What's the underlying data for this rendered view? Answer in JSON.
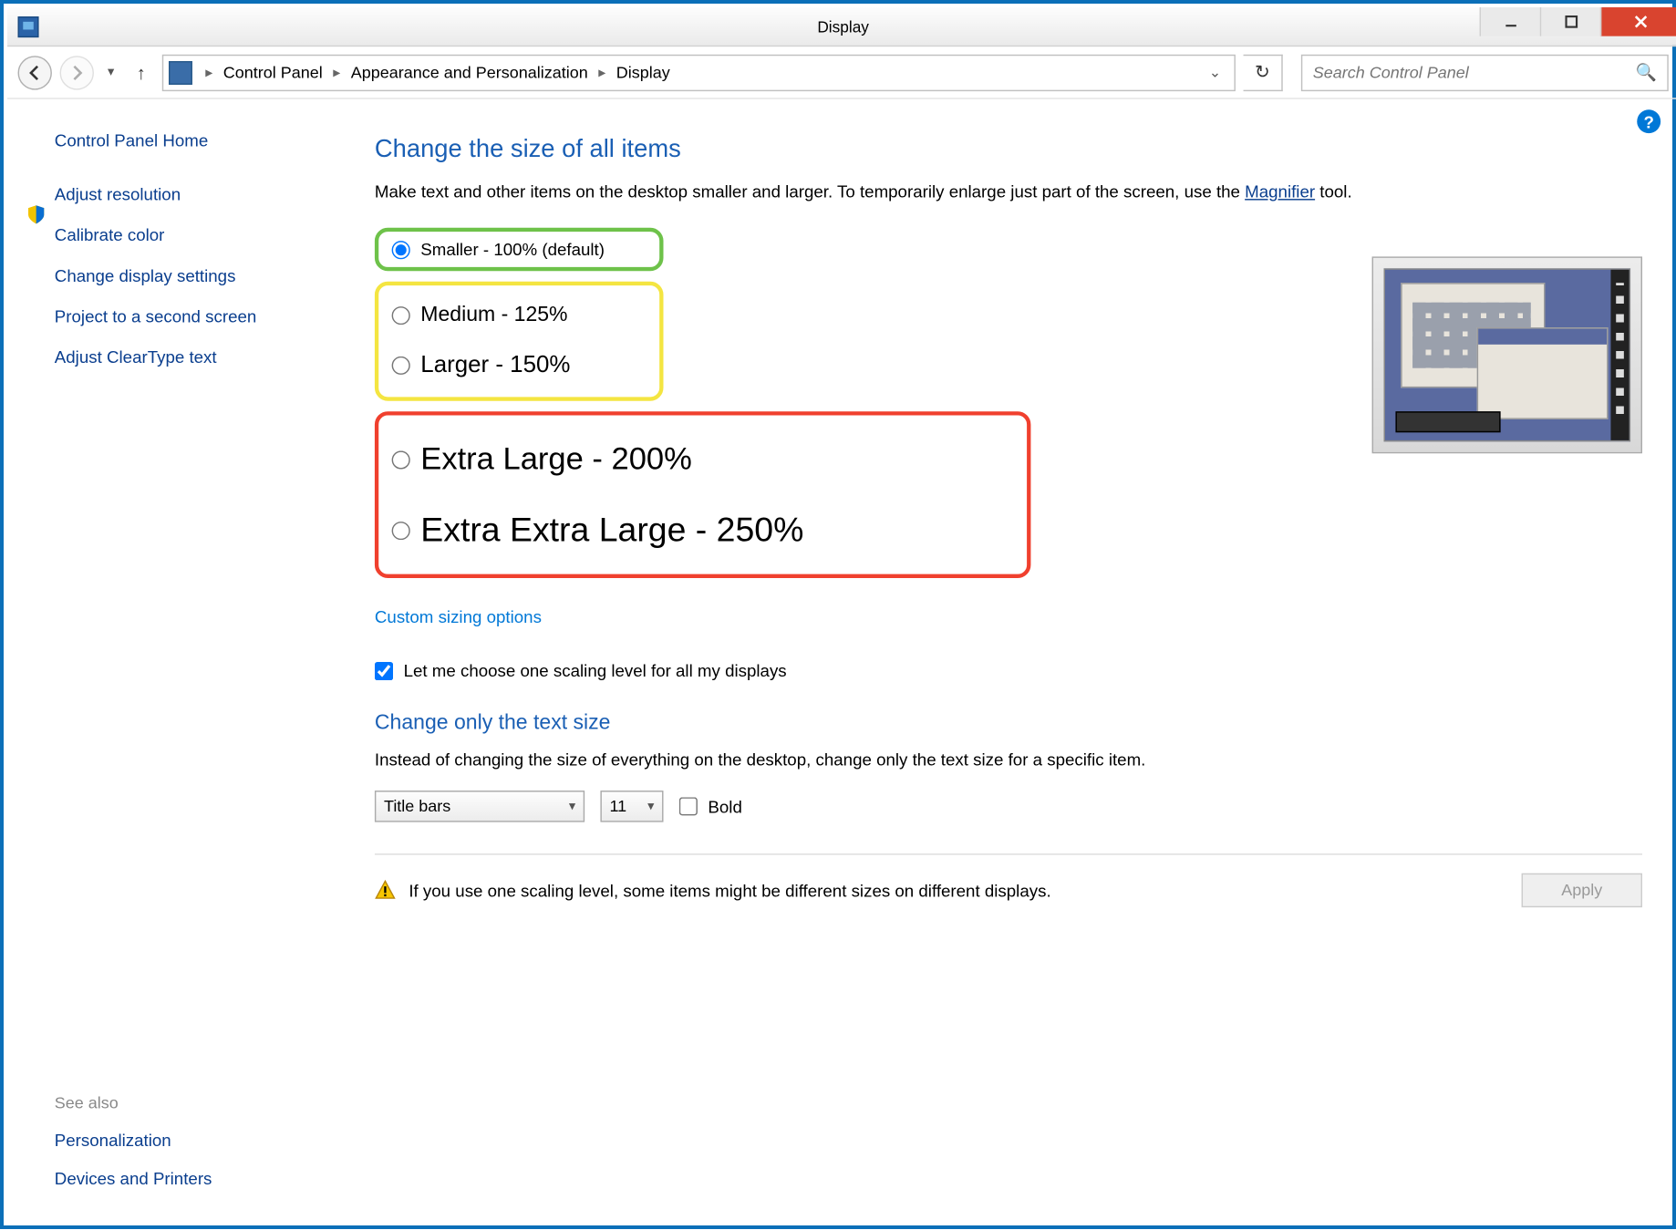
{
  "window": {
    "title": "Display"
  },
  "breadcrumbs": {
    "a": "Control Panel",
    "b": "Appearance and Personalization",
    "c": "Display"
  },
  "search": {
    "placeholder": "Search Control Panel"
  },
  "sidebar": {
    "home": "Control Panel Home",
    "items": {
      "adjust_resolution": "Adjust resolution",
      "calibrate_color": "Calibrate color",
      "change_display_settings": "Change display settings",
      "project_second_screen": "Project to a second screen",
      "adjust_cleartype": "Adjust ClearType text"
    },
    "see_also_hdr": "See also",
    "see_also": {
      "personalization": "Personalization",
      "devices_printers": "Devices and Printers"
    }
  },
  "main": {
    "h1": "Change the size of all items",
    "desc_a": "Make text and other items on the desktop smaller and larger. To temporarily enlarge just part of the screen, use the ",
    "desc_link": "Magnifier",
    "desc_b": " tool.",
    "radios": {
      "smaller": "Smaller - 100% (default)",
      "medium": "Medium - 125%",
      "larger": "Larger - 150%",
      "xlarge": "Extra Large - 200%",
      "xxlarge": "Extra Extra Large - 250%"
    },
    "custom_link": "Custom sizing options",
    "chk_label": "Let me choose one scaling level for all my displays",
    "h2": "Change only the text size",
    "desc2": "Instead of changing the size of everything on the desktop, change only the text size for a specific item.",
    "dd_item": "Title bars",
    "dd_size": "11",
    "bold_label": "Bold",
    "warn": "If you use one scaling level, some items might be different sizes on different displays.",
    "apply": "Apply"
  }
}
